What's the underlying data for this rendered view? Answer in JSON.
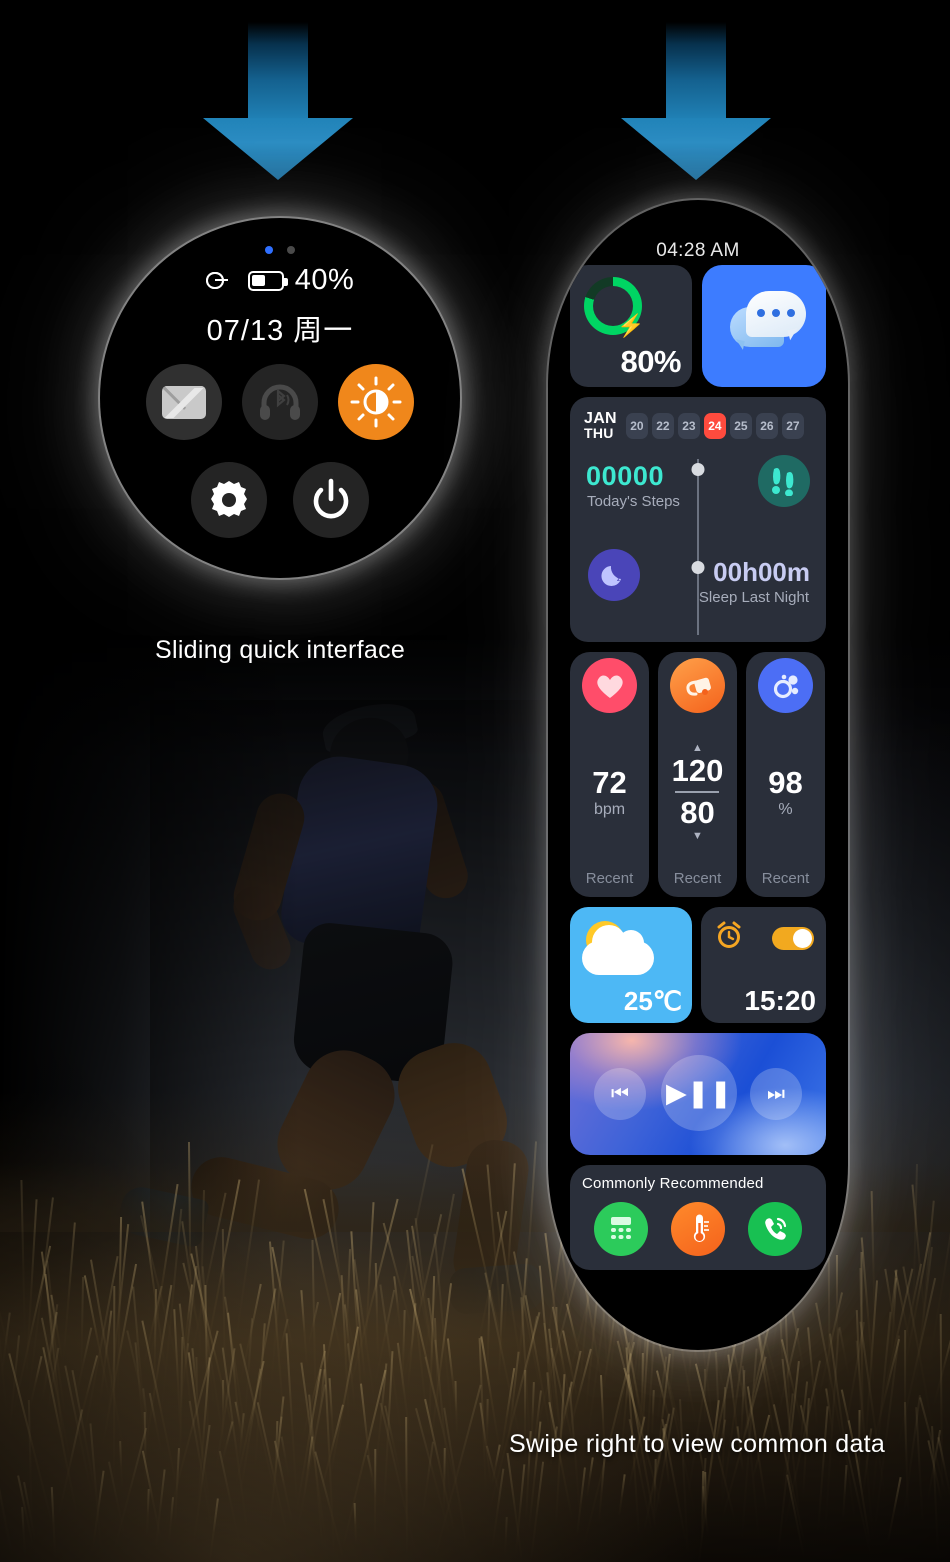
{
  "watch_round": {
    "page_dots": [
      "active",
      "inactive"
    ],
    "status": {
      "link_icon": "link-icon",
      "battery_icon": "battery-icon",
      "battery_percent": "40%"
    },
    "date_line": "07/13 周一",
    "quick_toggles": [
      {
        "name": "mail-toggle",
        "icon": "envelope-icon",
        "state": "default"
      },
      {
        "name": "bluetooth-audio-toggle",
        "icon": "headphones-bluetooth-icon",
        "state": "off"
      },
      {
        "name": "brightness-toggle",
        "icon": "brightness-sun-icon",
        "state": "on",
        "color": "#F0871B"
      },
      {
        "name": "settings-button",
        "icon": "gear-icon",
        "state": "default"
      },
      {
        "name": "power-button",
        "icon": "power-icon",
        "state": "default"
      }
    ],
    "caption": "Sliding quick interface"
  },
  "watch_band": {
    "time": "04:28 AM",
    "battery_tile": {
      "percent_label": "80%",
      "ring_percent": 80,
      "icon": "lightning-bolt-icon",
      "ring_color": "#00D563"
    },
    "messages_tile": {
      "icon": "chat-bubbles-icon",
      "color": "#3D7CFF"
    },
    "calendar_tile": {
      "month": "JAN",
      "weekday": "THU",
      "days": [
        "20",
        "22",
        "23",
        "24",
        "25",
        "26",
        "27"
      ],
      "selected_day": "24",
      "selected_color": "#FF4B3E",
      "steps_value": "00000",
      "steps_label": "Today's Steps",
      "steps_color": "#3DE8D0",
      "steps_icon": "footprints-icon",
      "sleep_value": "00h00m",
      "sleep_label": "Sleep Last Night",
      "sleep_icon": "moon-zzz-icon"
    },
    "vitals": [
      {
        "name": "heart-rate",
        "icon": "heart-icon",
        "icon_color": "#FF4D6A",
        "value": "72",
        "unit": "bpm",
        "status": "Recent"
      },
      {
        "name": "blood-pressure",
        "icon": "blood-pressure-cuff-icon",
        "icon_color": "#F97316",
        "systolic": "120",
        "diastolic": "80",
        "up_caret": "▲",
        "down_caret": "▼",
        "status": "Recent"
      },
      {
        "name": "blood-oxygen",
        "icon": "blood-oxygen-icon",
        "icon_color": "#4C6EF5",
        "value": "98",
        "unit": "%",
        "status": "Recent"
      }
    ],
    "weather_tile": {
      "icon": "sun-cloud-icon",
      "temperature": "25℃",
      "color": "#4DB8F5"
    },
    "alarm_tile": {
      "icon": "alarm-clock-icon",
      "toggle_state": "on",
      "time": "15:20"
    },
    "music_tile": {
      "prev_icon": "skip-previous-icon",
      "play_pause_icon": "play-pause-icon",
      "next_icon": "skip-next-icon"
    },
    "recommended_tile": {
      "title": "Commonly Recommended",
      "apps": [
        {
          "name": "calculator-app",
          "icon": "calculator-icon",
          "color": "#2CCB5B"
        },
        {
          "name": "thermometer-app",
          "icon": "thermometer-icon",
          "color": "#F4621C"
        },
        {
          "name": "phone-app",
          "icon": "phone-icon",
          "color": "#18C052"
        }
      ]
    },
    "caption": "Swipe right to view common data"
  },
  "arrows": [
    {
      "name": "down-arrow-left",
      "color": "#2183B8"
    },
    {
      "name": "down-arrow-right",
      "color": "#2183B8"
    }
  ]
}
